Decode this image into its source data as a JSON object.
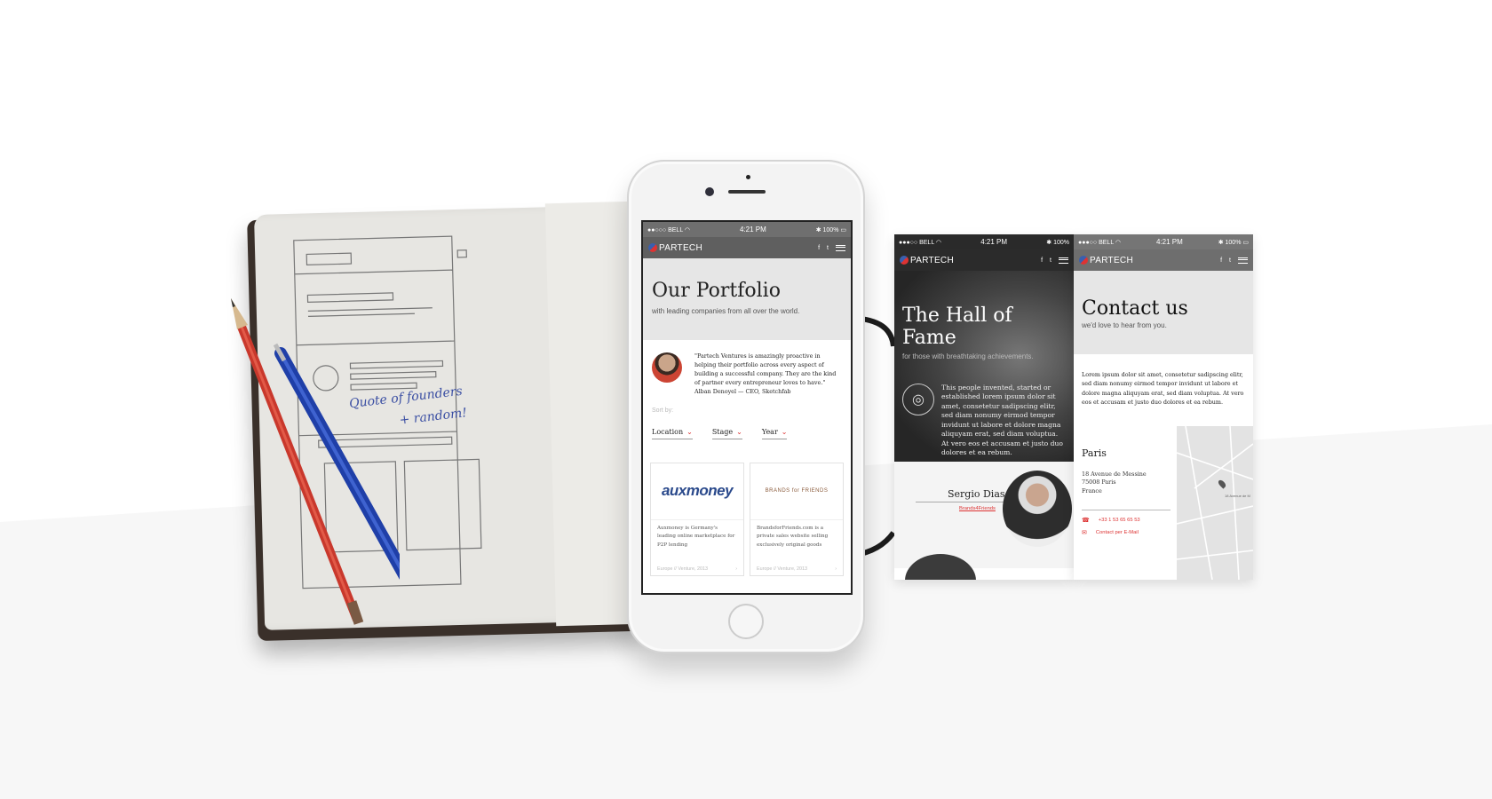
{
  "sketch": {
    "annotation_line1": "Quote of founders",
    "annotation_line2": "+ random!"
  },
  "phone_status": {
    "carrier": "BELL",
    "time": "4:21 PM",
    "battery": "100%"
  },
  "brand": "PARTECH",
  "social": {
    "facebook": "f",
    "twitter": "t"
  },
  "portfolio": {
    "title": "Our Portfolio",
    "subtitle": "with leading companies from all over the world.",
    "quote": "\"Partech Ventures is amazingly proactive in helping their portfolio across every aspect of building a successful company. They are the kind of partner every entrepreneur loves to have.\" Alban Denoyel — CEO, Sketchfab",
    "sort_label": "Sort by:",
    "sort_options": [
      "Location",
      "Stage",
      "Year"
    ],
    "cards": [
      {
        "logo": "auxmoney",
        "description": "Auxmoney is Germany's leading online marketplace for P2P lending",
        "meta": "Europe // Venture, 2013"
      },
      {
        "logo": "BRANDS for FRIENDS",
        "description": "BrandsforFriends.com is a private sales website selling exclusively original goods",
        "meta": "Europe // Venture, 2013"
      }
    ]
  },
  "hall_of_fame": {
    "title": "The Hall of Fame",
    "subtitle": "for those with breathtaking achievements.",
    "body": "This people invented, started or established lorem ipsum dolor sit amet, consetetur sadipscing elitr, sed diam nonumy eirmod tempor invidunt ut labore et dolore magna aliquyam erat, sed diam voluptua. At vero eos et accusam et justo duo dolores et ea rebum.",
    "person_name": "Sergio Dias",
    "person_link": "Brands4Friends"
  },
  "contact": {
    "title": "Contact us",
    "subtitle": "we'd love to hear from you.",
    "body": "Lorem ipsum dolor sit amet, consetetur sadipscing elitr, sed diam nonumy eirmod tempor invidunt ut labore et dolore magna aliquyam erat, sed diam voluptua. At vero eos et accusam et justo duo dolores et ea rebum.",
    "city": "Paris",
    "address_line1": "18 Avenue de Messine",
    "address_line2": "75008 Paris",
    "address_line3": "France",
    "phone": "+33 1 53 65 65 53",
    "email_link": "Contact per E-Mail",
    "map_label": "18 Avenue de M"
  },
  "colors": {
    "accent": "#d33a3a",
    "brand_blue": "#2b4a8c"
  }
}
